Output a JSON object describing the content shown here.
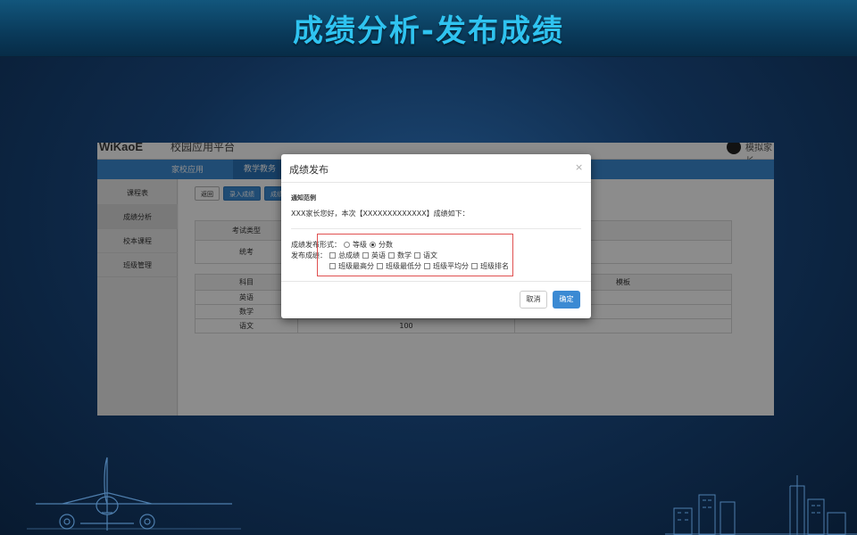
{
  "slide": {
    "title": "成绩分析-发布成绩"
  },
  "app": {
    "logo": "WiKaoE",
    "platform_name": "校园应用平台",
    "user_name": "模拟家长",
    "nav": [
      "家校应用",
      "教学教务"
    ],
    "sidebar": [
      "课程表",
      "成绩分析",
      "校本课程",
      "班级管理"
    ],
    "sidebar_active": "成绩分析",
    "toolbar": {
      "back": "返回",
      "enter_scores": "录入成绩",
      "publish": "成绩发布"
    },
    "exam_table": {
      "header": "考试类型",
      "value": "统考"
    },
    "score_table": {
      "headers": [
        "科目",
        "模板"
      ],
      "rows": [
        {
          "subject": "英语",
          "score": ""
        },
        {
          "subject": "数学",
          "score": ""
        },
        {
          "subject": "语文",
          "score": "100"
        }
      ]
    }
  },
  "modal": {
    "title": "成绩发布",
    "close": "×",
    "section_label": "通知范例",
    "notice_text": "XXX家长您好，本次【XXXXXXXXXXXXX】成绩如下：",
    "format_label": "成绩发布形式：",
    "format_options": [
      {
        "label": "等级",
        "selected": false
      },
      {
        "label": "分数",
        "selected": true
      }
    ],
    "publish_label": "发布成绩：",
    "publish_options_row1": [
      "总成绩",
      "英语",
      "数学",
      "语文"
    ],
    "publish_options_row2": [
      "班级最高分",
      "班级最低分",
      "班级平均分",
      "班级排名"
    ],
    "cancel": "取消",
    "ok": "确定"
  },
  "colors": {
    "title": "#2fc3f0",
    "primary_blue": "#3b8ad3",
    "highlight_red": "#e05050"
  }
}
